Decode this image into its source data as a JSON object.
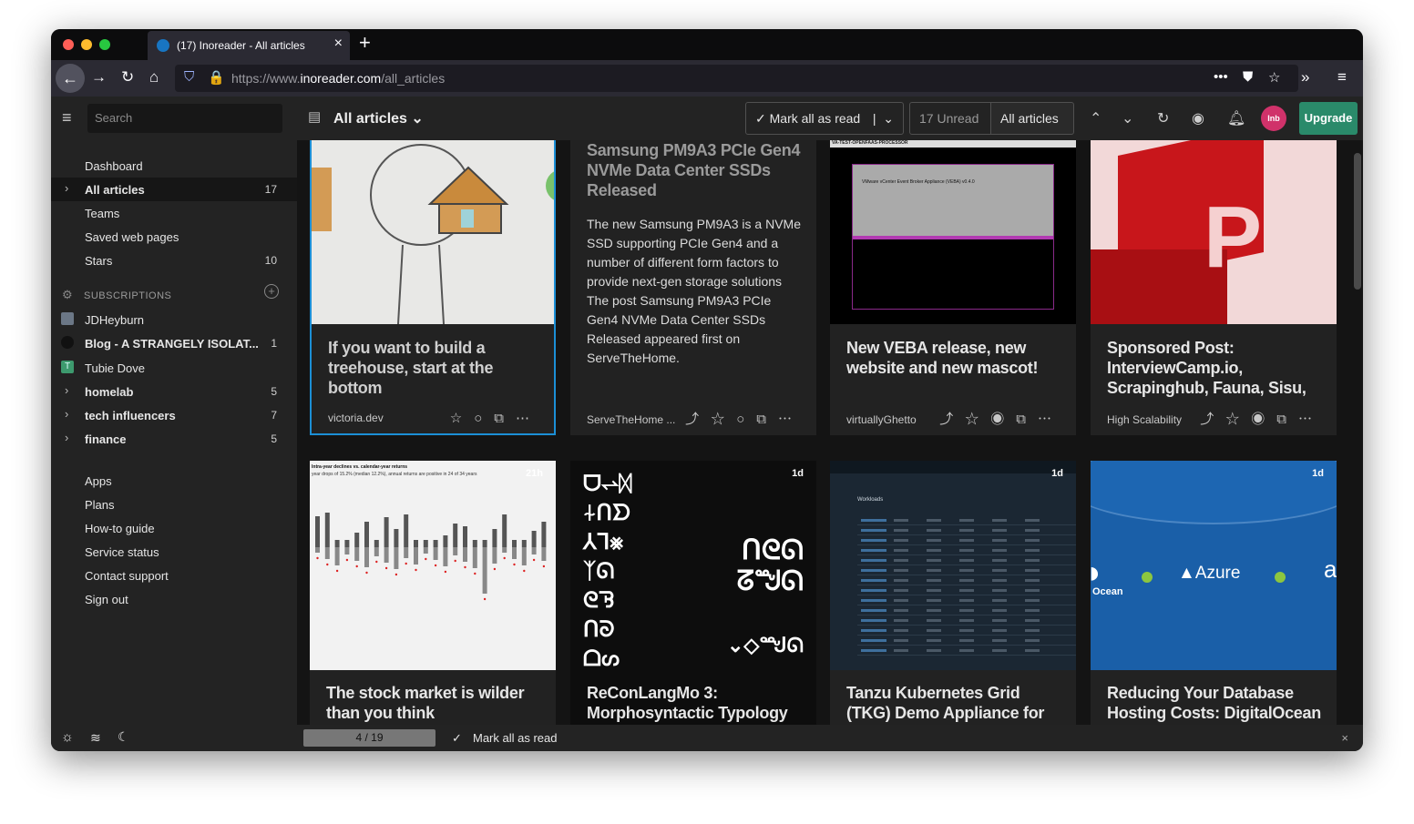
{
  "browser": {
    "tab_title": "(17) Inoreader - All articles",
    "url_prefix": "https://www.",
    "url_domain": "inoreader.com",
    "url_path": "/all_articles"
  },
  "sidebar": {
    "search_placeholder": "Search",
    "nav": [
      {
        "label": "Dashboard",
        "count": ""
      },
      {
        "label": "All articles",
        "count": "17"
      },
      {
        "label": "Teams",
        "count": ""
      },
      {
        "label": "Saved web pages",
        "count": ""
      },
      {
        "label": "Stars",
        "count": "10"
      }
    ],
    "subscriptions_heading": "SUBSCRIPTIONS",
    "feeds": [
      {
        "label": "JDHeyburn",
        "count": ""
      },
      {
        "label": "Blog - A STRANGELY ISOLAT...",
        "count": "1"
      },
      {
        "label": "Tubie Dove",
        "count": ""
      },
      {
        "label": "homelab",
        "count": "5"
      },
      {
        "label": "tech influencers",
        "count": "7"
      },
      {
        "label": "finance",
        "count": "5"
      }
    ],
    "links": [
      "Apps",
      "Plans",
      "How-to guide",
      "Service status",
      "Contact support",
      "Sign out"
    ]
  },
  "toolbar": {
    "title": "All articles",
    "mark_all_read": "Mark all as read",
    "unread": "17 Unread",
    "all_articles": "All articles",
    "upgrade": "Upgrade",
    "avatar_text": "Inb"
  },
  "cards": [
    {
      "title": "If you want to build a treehouse, start at the bottom",
      "source": "victoria.dev",
      "badge": ""
    },
    {
      "title": "Samsung PM9A3 PCIe Gen4 NVMe Data Center SSDs Released",
      "source": "ServeTheHome ...",
      "badge": "",
      "summary": "The new Samsung PM9A3 is a NVMe SSD supporting PCIe Gen4 and a number of different form factors to provide next-gen storage solutions The post Samsung PM9A3 PCIe Gen4 NVMe Data Center SSDs Released appeared first on ServeTheHome."
    },
    {
      "title": "New VEBA release, new website and new mascot!",
      "source": "virtuallyGhetto",
      "badge": ""
    },
    {
      "title": "Sponsored Post: InterviewCamp.io, Scrapinghub, Fauna, Sisu,",
      "source": "High Scalability",
      "badge": ""
    },
    {
      "title": "The stock market is wilder than you think",
      "source": "",
      "badge": "21h"
    },
    {
      "title": "ReConLangMo 3: Morphosyntactic Typology",
      "source": "",
      "badge": "1d"
    },
    {
      "title": "Tanzu Kubernetes Grid (TKG) Demo Appliance for VMC and",
      "source": "",
      "badge": "1d"
    },
    {
      "title": "Reducing Your Database Hosting Costs: DigitalOcean",
      "source": "",
      "badge": "1d"
    }
  ],
  "card_images": {
    "chart_title": "Intra-year declines vs. calendar-year returns",
    "chart_sub": "year drops of 15.2% (median 12.2%), annual returns are positive in 24 of 34 years",
    "azure": "Azure",
    "ocean": "Ocean",
    "veba_header": "VA-TEST-OPENFAAS-PROCESSOR",
    "veba_text": "VMware vCenter Event Broker Appliance (VEBA) v0.4.0",
    "k8s_label": "Workloads",
    "ppt_letter": "P"
  },
  "statusbar": {
    "position": "4 / 19",
    "mark_all_read": "Mark all as read"
  }
}
